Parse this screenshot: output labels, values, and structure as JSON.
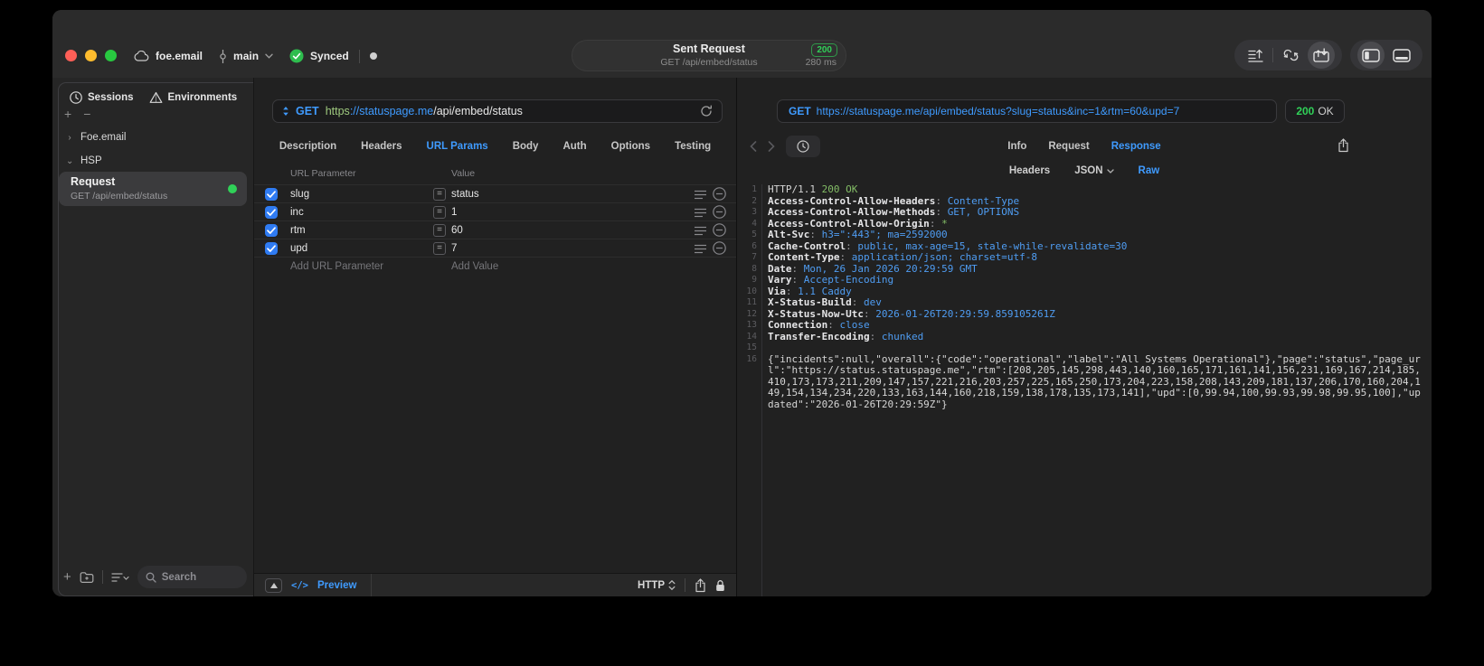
{
  "colors": {
    "accent": "#3f9bff",
    "success": "#30d158",
    "code_green": "#83bd66",
    "code_blue": "#4f9df3"
  },
  "titlebar": {
    "workspace": "foe.email",
    "branch": "main",
    "sync_status": "Synced",
    "request_title": "Sent Request",
    "request_subtitle": "GET /api/embed/status",
    "status_code": "200",
    "response_time": "280 ms"
  },
  "sidebar": {
    "tabs": [
      {
        "label": "Sessions",
        "active": true
      },
      {
        "label": "Environments",
        "active": false
      }
    ],
    "tree": [
      {
        "label": "Foe.email",
        "expanded": false
      },
      {
        "label": "HSP",
        "expanded": true
      }
    ],
    "request_item": {
      "name": "Request",
      "detail": "GET /api/embed/status",
      "selected": true
    },
    "search_placeholder": "Search"
  },
  "request_panel": {
    "method": "GET",
    "url_segments": [
      {
        "text": "https",
        "color": "green"
      },
      {
        "text": "://statuspage.me",
        "color": "blue"
      },
      {
        "text": "/api/embed/status",
        "color": "white"
      }
    ],
    "tabs": [
      {
        "label": "Description",
        "active": false
      },
      {
        "label": "Headers",
        "active": false
      },
      {
        "label": "URL Params",
        "active": true
      },
      {
        "label": "Body",
        "active": false
      },
      {
        "label": "Auth",
        "active": false
      },
      {
        "label": "Options",
        "active": false
      },
      {
        "label": "Testing",
        "active": false
      }
    ],
    "table": {
      "columns": [
        "URL Parameter",
        "Value"
      ],
      "operator": "=",
      "rows": [
        {
          "checked": true,
          "name": "slug",
          "value": "status"
        },
        {
          "checked": true,
          "name": "inc",
          "value": "1"
        },
        {
          "checked": true,
          "name": "rtm",
          "value": "60"
        },
        {
          "checked": true,
          "name": "upd",
          "value": "7"
        }
      ],
      "add_parameter_placeholder": "Add URL Parameter",
      "add_value_placeholder": "Add Value"
    },
    "footer": {
      "code_glyph": "</>",
      "preview_label": "Preview",
      "protocol": "HTTP"
    }
  },
  "response_panel": {
    "method": "GET",
    "url": "https://statuspage.me/api/embed/status?slug=status&inc=1&rtm=60&upd=7",
    "status_code": "200",
    "status_text": "OK",
    "tabs": [
      {
        "label": "Info",
        "active": false
      },
      {
        "label": "Request",
        "active": false
      },
      {
        "label": "Response",
        "active": true
      }
    ],
    "subtabs": [
      {
        "label": "Headers",
        "active": false,
        "chevron": false
      },
      {
        "label": "JSON",
        "active": false,
        "chevron": true
      },
      {
        "label": "Raw",
        "active": true,
        "chevron": false
      }
    ],
    "body_lines": [
      {
        "n": 1,
        "seg": [
          [
            "HTTP/1.1 ",
            "w"
          ],
          [
            "200 OK",
            "g"
          ]
        ]
      },
      {
        "n": 2,
        "seg": [
          [
            "Access-Control-Allow-Headers",
            "k"
          ],
          [
            ": ",
            "p"
          ],
          [
            "Content-Type",
            "v"
          ]
        ]
      },
      {
        "n": 3,
        "seg": [
          [
            "Access-Control-Allow-Methods",
            "k"
          ],
          [
            ": ",
            "p"
          ],
          [
            "GET, OPTIONS",
            "v"
          ]
        ]
      },
      {
        "n": 4,
        "seg": [
          [
            "Access-Control-Allow-Origin",
            "k"
          ],
          [
            ": ",
            "p"
          ],
          [
            "*",
            "g"
          ]
        ]
      },
      {
        "n": 5,
        "seg": [
          [
            "Alt-Svc",
            "k"
          ],
          [
            ": ",
            "p"
          ],
          [
            "h3=\":443\"; ma=2592000",
            "v"
          ]
        ]
      },
      {
        "n": 6,
        "seg": [
          [
            "Cache-Control",
            "k"
          ],
          [
            ": ",
            "p"
          ],
          [
            "public, max-age=15, stale-while-revalidate=30",
            "v"
          ]
        ]
      },
      {
        "n": 7,
        "seg": [
          [
            "Content-Type",
            "k"
          ],
          [
            ": ",
            "p"
          ],
          [
            "application/json; charset=utf-8",
            "v"
          ]
        ]
      },
      {
        "n": 8,
        "seg": [
          [
            "Date",
            "k"
          ],
          [
            ": ",
            "p"
          ],
          [
            "Mon, 26 Jan 2026 20:29:59 GMT",
            "v"
          ]
        ]
      },
      {
        "n": 9,
        "seg": [
          [
            "Vary",
            "k"
          ],
          [
            ": ",
            "p"
          ],
          [
            "Accept-Encoding",
            "v"
          ]
        ]
      },
      {
        "n": 10,
        "seg": [
          [
            "Via",
            "k"
          ],
          [
            ": ",
            "p"
          ],
          [
            "1.1 Caddy",
            "v"
          ]
        ]
      },
      {
        "n": 11,
        "seg": [
          [
            "X-Status-Build",
            "k"
          ],
          [
            ": ",
            "p"
          ],
          [
            "dev",
            "v"
          ]
        ]
      },
      {
        "n": 12,
        "seg": [
          [
            "X-Status-Now-Utc",
            "k"
          ],
          [
            ": ",
            "p"
          ],
          [
            "2026-01-26T20:29:59.859105261Z",
            "v"
          ]
        ]
      },
      {
        "n": 13,
        "seg": [
          [
            "Connection",
            "k"
          ],
          [
            ": ",
            "p"
          ],
          [
            "close",
            "v"
          ]
        ]
      },
      {
        "n": 14,
        "seg": [
          [
            "Transfer-Encoding",
            "k"
          ],
          [
            ": ",
            "p"
          ],
          [
            "chunked",
            "v"
          ]
        ]
      },
      {
        "n": 15,
        "seg": []
      },
      {
        "n": 16,
        "seg": [
          [
            "{\"incidents\":null,\"overall\":{\"code\":\"operational\",\"label\":\"All Systems Operational\"},\"page\":\"status\",\"page_url\":\"https://status.statuspage.me\",\"rtm\":[208,205,145,298,443,140,160,165,171,161,141,156,231,169,167,214,185,410,173,173,211,209,147,157,221,216,203,257,225,165,250,173,204,223,158,208,143,209,181,137,206,170,160,204,149,154,134,234,220,133,163,144,160,218,159,138,178,135,173,141],\"upd\":[0,99.94,100,99.93,99.98,99.95,100],\"updated\":\"2026-01-26T20:29:59Z\"}",
            "w"
          ]
        ]
      }
    ]
  }
}
